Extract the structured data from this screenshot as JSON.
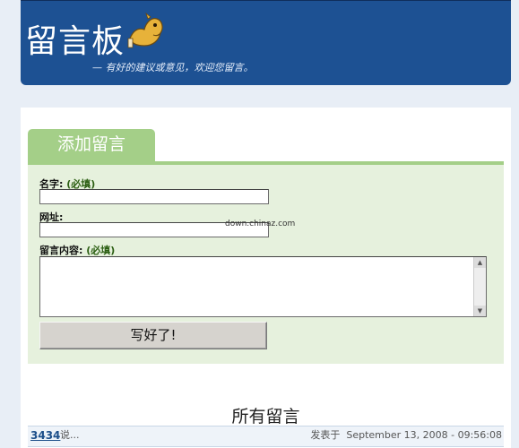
{
  "header": {
    "title": "留言板",
    "slogan": "— 有好的建议或意见，欢迎您留言。",
    "mascot_icon": "camel-mascot-icon"
  },
  "form": {
    "tab_label": "添加留言",
    "name_label": "名字:",
    "name_required": "(必填)",
    "name_value": "",
    "url_label": "网址:",
    "url_value": "",
    "content_label": "留言内容:",
    "content_required": "(必填)",
    "content_value": "",
    "submit_label": "写好了!"
  },
  "watermark": "down.chinaz.com",
  "messages": {
    "section_title": "所有留言",
    "entries": [
      {
        "author": "3434",
        "says": "说...",
        "posted_prefix": "发表于",
        "timestamp": "September 13, 2008 - 09:56:08"
      }
    ]
  },
  "colors": {
    "header_bg": "#1d5193",
    "tab_green": "#a4cf88",
    "form_bg": "#e6f1dd",
    "page_bg": "#e8eef6"
  }
}
